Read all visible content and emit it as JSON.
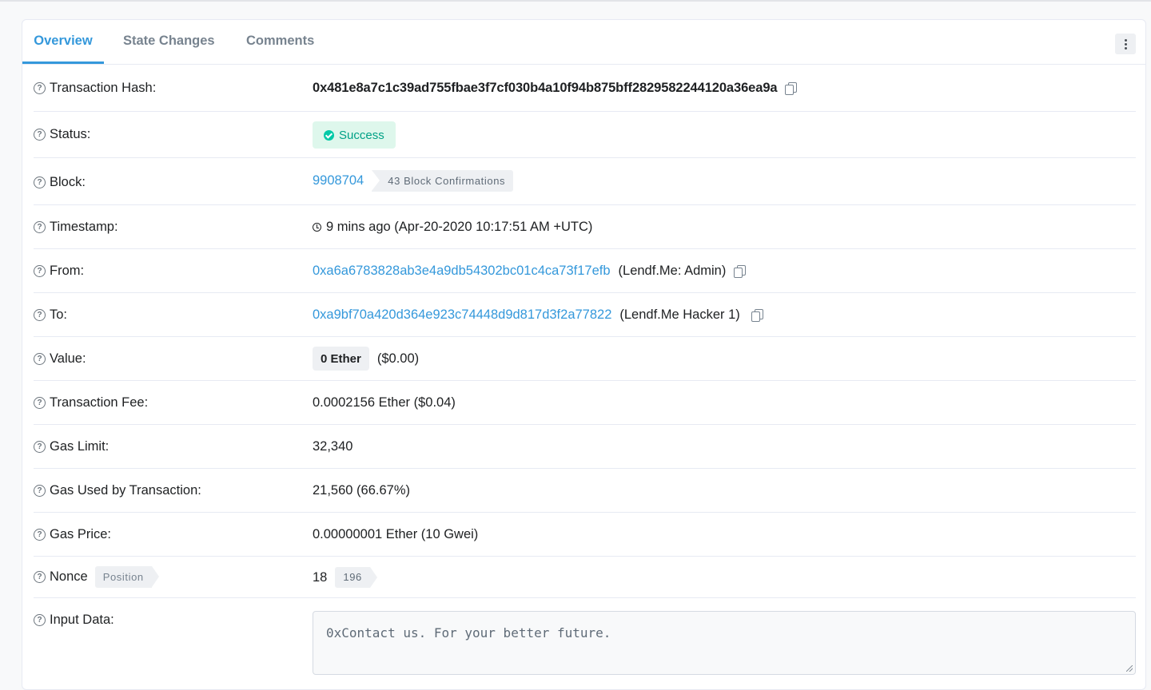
{
  "tabs": [
    {
      "label": "Overview",
      "active": true
    },
    {
      "label": "State Changes",
      "active": false
    },
    {
      "label": "Comments",
      "active": false
    }
  ],
  "fields": {
    "tx_hash": {
      "label": "Transaction Hash:",
      "value": "0x481e8a7c1c39ad755fbae3f7cf030b4a10f94b875bff2829582244120a36ea9a"
    },
    "status": {
      "label": "Status:",
      "value": "Success"
    },
    "block": {
      "label": "Block:",
      "value": "9908704",
      "confirmations": "43 Block Confirmations"
    },
    "timestamp": {
      "label": "Timestamp:",
      "value": "9 mins ago (Apr-20-2020 10:17:51 AM +UTC)"
    },
    "from": {
      "label": "From:",
      "address": "0xa6a6783828ab3e4a9db54302bc01c4ca73f17efb",
      "tag": "(Lendf.Me: Admin)"
    },
    "to": {
      "label": "To:",
      "address": "0xa9bf70a420d364e923c74448d9d817d3f2a77822",
      "tag": "(Lendf.Me Hacker 1)"
    },
    "value": {
      "label": "Value:",
      "amount": "0 Ether",
      "usd": "($0.00)"
    },
    "tx_fee": {
      "label": "Transaction Fee:",
      "value": "0.0002156 Ether ($0.04)"
    },
    "gas_limit": {
      "label": "Gas Limit:",
      "value": "32,340"
    },
    "gas_used": {
      "label": "Gas Used by Transaction:",
      "value": "21,560 (66.67%)"
    },
    "gas_price": {
      "label": "Gas Price:",
      "value": "0.00000001 Ether (10 Gwei)"
    },
    "nonce": {
      "label": "Nonce",
      "position_label": "Position",
      "value": "18",
      "position": "196"
    },
    "input_data": {
      "label": "Input Data:",
      "value": "0xContact us. For your better future."
    }
  },
  "colors": {
    "accent": "#3498db",
    "success_bg": "#def7ec",
    "success_text": "#00a186"
  }
}
